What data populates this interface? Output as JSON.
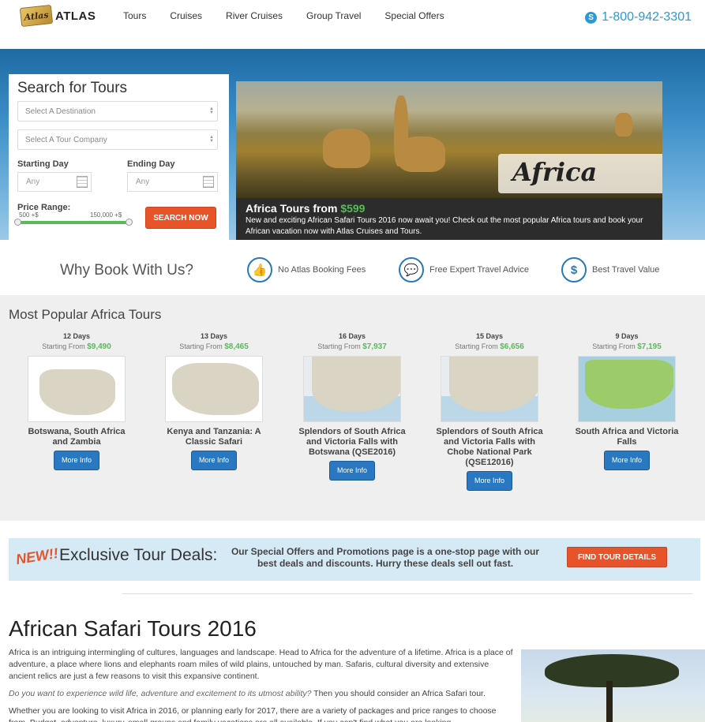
{
  "header": {
    "logo_badge": "Atlas",
    "logo_text": "ATLAS",
    "nav": [
      "Tours",
      "Cruises",
      "River Cruises",
      "Group Travel",
      "Special Offers"
    ],
    "phone": "1-800-942-3301"
  },
  "search": {
    "title": "Search for Tours",
    "destination_placeholder": "Select A Destination",
    "company_placeholder": "Select A Tour Company",
    "start_label": "Starting Day",
    "end_label": "Ending Day",
    "start_placeholder": "Any",
    "end_placeholder": "Any",
    "price_label": "Price Range:",
    "price_min": "500 +$",
    "price_max": "150,000 +$",
    "button": "SEARCH NOW"
  },
  "banner": {
    "overlay_label": "Africa",
    "title_prefix": "Africa Tours from",
    "title_price": "$599",
    "text": "New and exciting African Safari Tours 2016 now await you! Check out the most popular Africa tours and book your African vacation now with Atlas Cruises and Tours."
  },
  "why": {
    "title": "Why Book With Us?",
    "items": [
      {
        "icon": "thumbs-up-icon",
        "label": "No Atlas Booking Fees"
      },
      {
        "icon": "chat-icon",
        "label": "Free Expert Travel Advice"
      },
      {
        "icon": "dollar-icon",
        "label": "Best Travel Value"
      }
    ]
  },
  "popular": {
    "title": "Most Popular Africa Tours",
    "starting_from": "Starting From",
    "button": "More Info",
    "tours": [
      {
        "days": "12 Days",
        "price": "$9,490",
        "name": "Botswana, South Africa and Zambia"
      },
      {
        "days": "13 Days",
        "price": "$8,465",
        "name": "Kenya and Tanzania: A Classic Safari"
      },
      {
        "days": "16 Days",
        "price": "$7,937",
        "name": "Splendors of South Africa and Victoria Falls with Botswana (QSE2016)"
      },
      {
        "days": "15 Days",
        "price": "$6,656",
        "name": "Splendors of South Africa and Victoria Falls with Chobe National Park (QSE12016)"
      },
      {
        "days": "9 Days",
        "price": "$7,195",
        "name": "South Africa and Victoria Falls"
      }
    ]
  },
  "deals": {
    "new_label": "NEW!!",
    "title": "Exclusive Tour Deals:",
    "text": "Our Special Offers and Promotions page is a one-stop page with our best deals and discounts. Hurry these deals sell out fast.",
    "button": "FIND TOUR DETAILS"
  },
  "article": {
    "title": "African Safari Tours 2016",
    "p1": "Africa is an intriguing intermingling of cultures, languages and landscape. Head to Africa for the adventure of a lifetime.  Africa is a place of adventure, a place where lions and elephants roam miles of wild plains, untouched by man. Safaris, cultural diversity and extensive ancient relics are just a few reasons to visit this expansive continent.",
    "p2_italic": "Do you want to experience wild life, adventure and excitement to its utmost ability?",
    "p2_rest": " Then you should consider an Africa Safari tour.",
    "p3": "Whether you are looking to visit Africa in 2016, or planning early for 2017, there are a variety of packages and price ranges to choose from. Budget, adventure, luxury, small groups and family vacations are all available. If you can't find what you are looking"
  },
  "colors": {
    "accent_orange": "#e8542a",
    "accent_blue": "#2a78c2",
    "price_green": "#5cb85c"
  }
}
